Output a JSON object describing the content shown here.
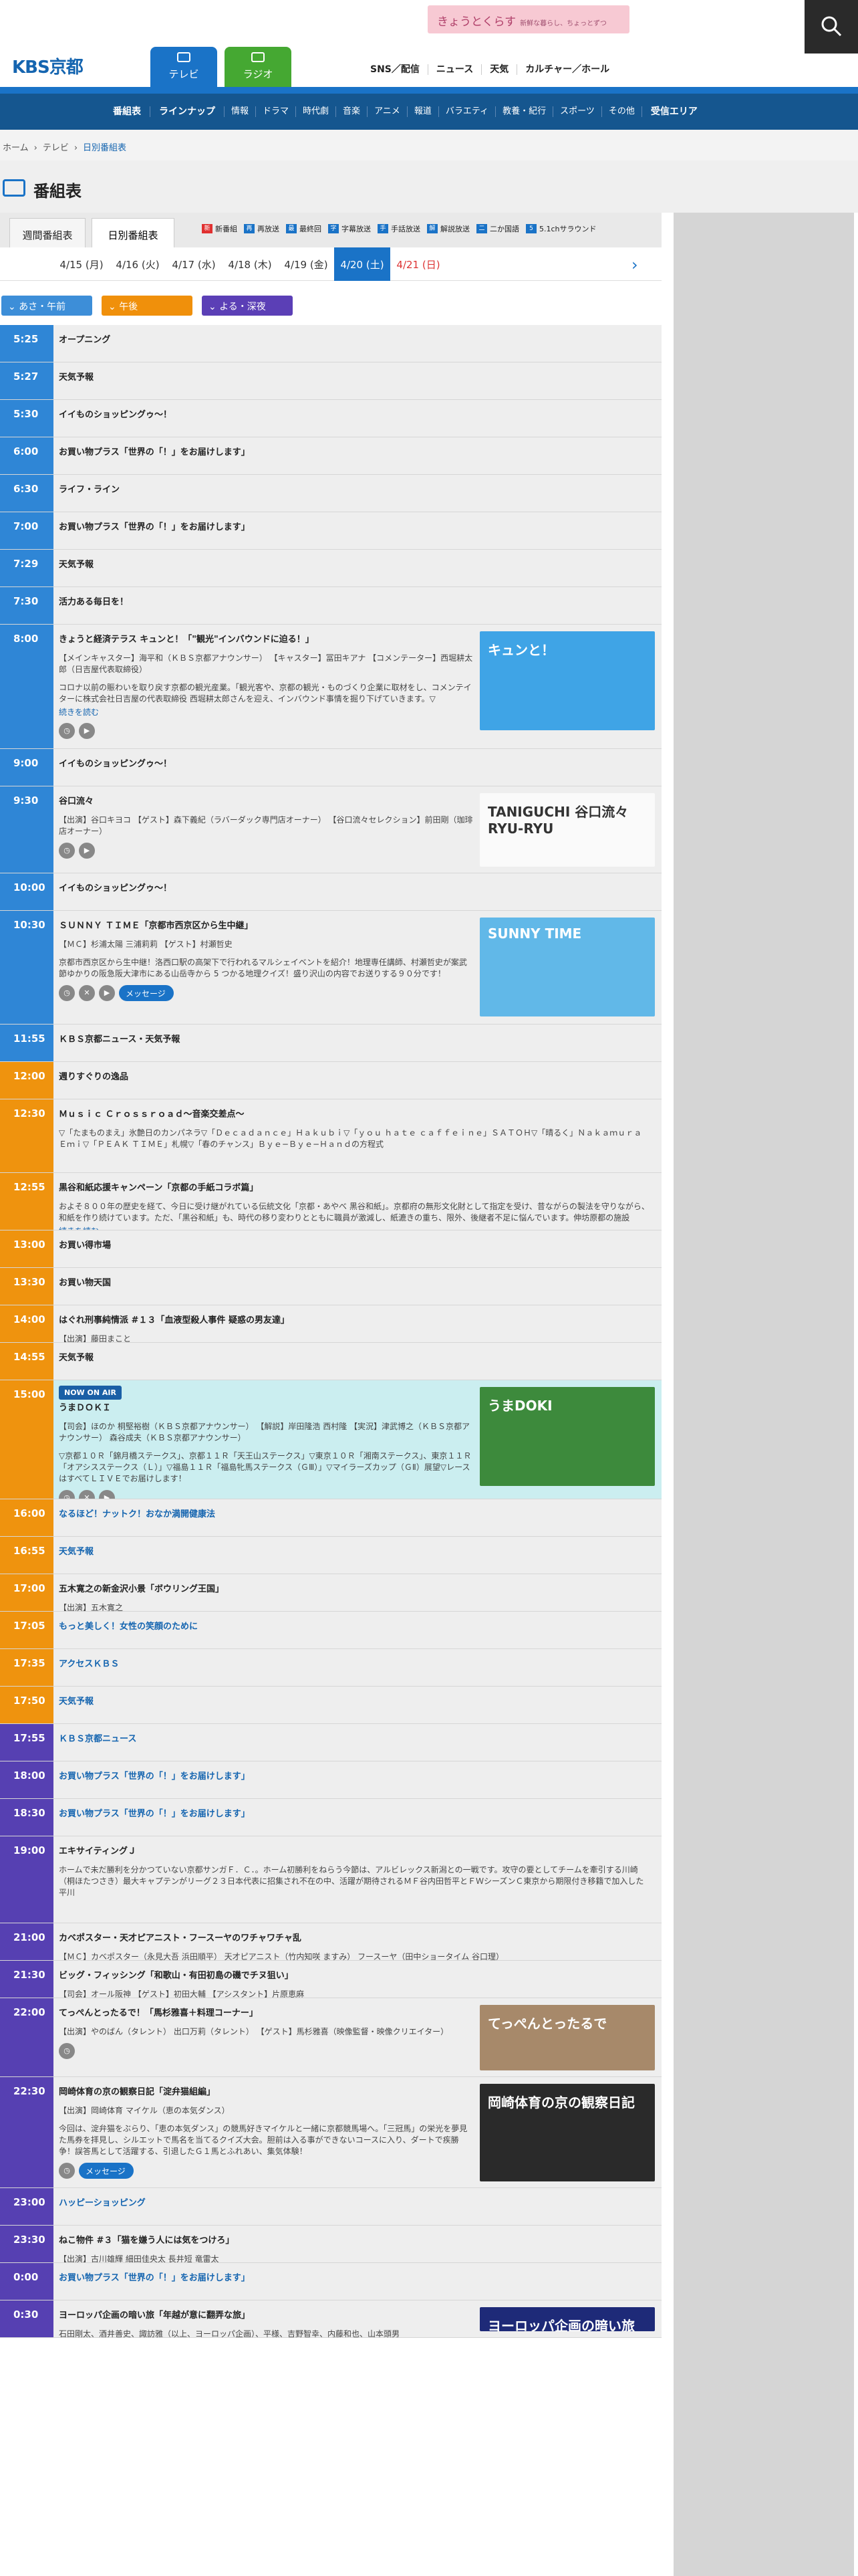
{
  "header": {
    "promo_text": "きょうとくらす",
    "promo_sub": "新鮮な暮らし、ちょっとずつ",
    "logo_text": "KBS京都",
    "tab_tv": "テレビ",
    "tab_radio": "ラジオ",
    "topnav": [
      "SNS／配信",
      "ニュース",
      "天気",
      "カルチャー／ホール"
    ]
  },
  "mainnav": [
    "番組表",
    "ラインナップ",
    "情報",
    "ドラマ",
    "時代劇",
    "音楽",
    "アニメ",
    "報道",
    "バラエティ",
    "教養・紀行",
    "スポーツ",
    "その他",
    "受信エリア"
  ],
  "breadcrumb": [
    "ホーム",
    "テレビ",
    "日別番組表"
  ],
  "page_title": "番組表",
  "tabs": {
    "weekly": "週間番組表",
    "daily": "日別番組表"
  },
  "legend": [
    {
      "mark": "新",
      "label": "新番組",
      "color": "#e03030"
    },
    {
      "mark": "再",
      "label": "再放送",
      "color": "#1a73c7"
    },
    {
      "mark": "最",
      "label": "最終回",
      "color": "#1a73c7"
    },
    {
      "mark": "字",
      "label": "字幕放送",
      "color": "#1a73c7"
    },
    {
      "mark": "手",
      "label": "手話放送",
      "color": "#1a73c7"
    },
    {
      "mark": "解",
      "label": "解説放送",
      "color": "#1a73c7"
    },
    {
      "mark": "二",
      "label": "二か国語",
      "color": "#1a73c7"
    },
    {
      "mark": "5",
      "label": "5.1chサラウンド",
      "color": "#1a73c7"
    }
  ],
  "dates": [
    "4/15 (月)",
    "4/16 (火)",
    "4/17 (水)",
    "4/18 (木)",
    "4/19 (金)",
    "4/20 (土)",
    "4/21 (日)"
  ],
  "filters": [
    "あさ・午前",
    "午後",
    "よる・深夜"
  ],
  "now_label": "NOW ON AIR",
  "more_label": "続きを読む",
  "message_label": "メッセージ",
  "programs": [
    {
      "time": "5:25",
      "title": "オープニング"
    },
    {
      "time": "5:27",
      "title": "天気予報"
    },
    {
      "time": "5:30",
      "title": "イイものショッピングゥ〜！"
    },
    {
      "time": "6:00",
      "title": "お買い物プラス「世界の「！」をお届けします」"
    },
    {
      "time": "6:30",
      "title": "ライフ・ライン"
    },
    {
      "time": "7:00",
      "title": "お買い物プラス「世界の「！」をお届けします」"
    },
    {
      "time": "7:29",
      "title": "天気予報"
    },
    {
      "time": "7:30",
      "title": "活力ある毎日を！"
    },
    {
      "time": "8:00",
      "title": "きょうと経済テラス キュンと！「\"観光\"インバウンドに迫る！」",
      "desc": "【メインキャスター】海平和（ＫＢＳ京都アナウンサー） 【キャスター】冨田キアナ 【コメンテーター】西堀耕太郎（日吉屋代表取締役）\nコロナ以前の賑わいを取り戻す京都の観光産業。「観光客や、京都の観光・ものづくり企業に取材をし、コメンテイターに株式会社日吉屋の代表取締役 西堀耕太郎さんを迎え、インバウンド事情を掘り下げていきます。▽",
      "thumb_caption": "キュンと！"
    },
    {
      "time": "9:00",
      "title": "イイものショッピングゥ〜！"
    },
    {
      "time": "9:30",
      "title": "谷口流々",
      "desc": "【出演】谷口キヨコ 【ゲスト】森下義紀（ラバーダック専門店オーナー） 【谷口流々セレクション】前田剛（珈琲店オーナー）",
      "thumb_caption": "TANIGUCHI 谷口流々 RYU-RYU"
    },
    {
      "time": "10:00",
      "title": "イイものショッピングゥ〜！"
    },
    {
      "time": "10:30",
      "title": "ＳＵＮＮＹ ＴＩＭＥ「京都市西京区から生中継」",
      "desc": "【ＭＣ】杉浦太陽 三浦莉莉 【ゲスト】村瀬哲史\n京都市西京区から生中継！洛西口駅の高架下で行われるマルシェイベントを紹介！地理専任講師、村瀬哲史が案武節ゆかりの阪急阪大津市にある山岳寺から 5 つかる地理クイズ！盛り沢山の内容でお送りする９０分です！",
      "thumb_caption": "SUNNY TIME"
    },
    {
      "time": "11:55",
      "title": "ＫＢＳ京都ニュース・天気予報"
    },
    {
      "time": "12:00",
      "title": "週りすぐりの逸品"
    },
    {
      "time": "12:30",
      "title": "Ｍｕｓｉｃ Ｃｒｏｓｓｒｏａｄ〜音楽交差点〜",
      "desc": "▽「たまものまえ」氷艶日のカンパネラ▽「Ｄｅｃａｄａｎｃｅ」Ｈａｋｕｂｉ▽「ｙｏｕ ｈａｔｅ ｃａｆｆｅｉｎｅ」ＳＡＴＯＨ▽「晴るく」Ｎａｋａｍｕｒａ Ｅｍｉ▽「ＰＥＡＫ ＴＩＭＥ」札幌▽「春のチャンス」Ｂｙｅ−Ｂｙｅ−Ｈａｎｄの方程式"
    },
    {
      "time": "12:55",
      "title": "黒谷和紙応援キャンペーン「京都の手紙コラボ篇」",
      "desc": "およそ８００年の歴史を経て、今日に受け継がれている伝統文化「京都・あやべ 黒谷和紙」。京都府の無形文化財として指定を受け、昔ながらの製法を守りながら、和紙を作り続けています。ただ、「黒谷和紙」も、時代の移り変わりとともに職員が激減し、紙漉きの重ち、限外、後継者不足に悩んでいます。伸坊原都の施設"
    },
    {
      "time": "13:00",
      "title": "お買い得市場"
    },
    {
      "time": "13:30",
      "title": "お買い物天国"
    },
    {
      "time": "14:00",
      "title": "はぐれ刑事純情派 #１３「血液型殺人事件 疑惑の男友達」",
      "desc": "【出演】藤田まこと"
    },
    {
      "time": "14:55",
      "title": "天気予報"
    },
    {
      "time": "15:00",
      "title": "うまＤＯＫＩ",
      "desc": "【司会】ほのか 桐堅裕樹（ＫＢＳ京都アナウンサー） 【解説】岸田隆浩 西村隆 【実況】津武博之（ＫＢＳ京都アナウンサー） 森谷成夫（ＫＢＳ京都アナウンサー）\n▽京都１０Ｒ「錦月橋ステークス」、京都１１Ｒ「天王山ステークス」▽東京１０Ｒ「湘南ステークス」、東京１１Ｒ「オアシスステークス（Ｌ）」▽福島１１Ｒ「福島牝馬ステークス（ＧⅢ）」▽マイラーズカップ（ＧⅡ）展望▽レースはすべてＬＩＶＥでお届けします！",
      "thumb_caption": "うまDOKI"
    },
    {
      "time": "16:00",
      "title": "なるほど！ナットク！おなか満開健康法"
    },
    {
      "time": "16:55",
      "title": "天気予報"
    },
    {
      "time": "17:00",
      "title": "五木寛之の新金沢小景「ボウリング王国」",
      "desc": "【出演】五木寛之"
    },
    {
      "time": "17:05",
      "title": "もっと美しく！女性の笑顔のために"
    },
    {
      "time": "17:35",
      "title": "アクセスＫＢＳ"
    },
    {
      "time": "17:50",
      "title": "天気予報"
    },
    {
      "time": "17:55",
      "title": "ＫＢＳ京都ニュース"
    },
    {
      "time": "18:00",
      "title": "お買い物プラス「世界の「！」をお届けします」"
    },
    {
      "time": "18:30",
      "title": "お買い物プラス「世界の「！」をお届けします」"
    },
    {
      "time": "19:00",
      "title": "エキサイティングＪ",
      "desc": "ホームで未だ勝利を分かつていない京都サンガＦ．Ｃ．。ホーム初勝利をねらう今節は、アルビレックス新潟との一戦です。攻守の要としてチームを牽引する川崎（桐ほたつさき）最大キャプテンがリーグ２３日本代表に招集され不在の中、活躍が期待されるＭＦ谷内田哲平とＦＷシーズンＣ東京から期限付き移籍で加入した平川"
    },
    {
      "time": "21:00",
      "title": "カベポスター・天才ピアニスト・フースーヤのワチャワチャ乱",
      "desc": "【ＭＣ】カベポスター（永見大吾 浜田順平） 天才ピアニスト（竹内知咲 ますみ） フースーヤ（田中ショータイム 谷口理）"
    },
    {
      "time": "21:30",
      "title": "ビッグ・フィッシング「和歌山・有田初島の磯でチヌ狙い」",
      "desc": "【司会】オール阪神 【ゲスト】初田大輔 【アシスタント】片原恵麻"
    },
    {
      "time": "22:00",
      "title": "てっぺんとったるで！「馬杉雅喜＋料理コーナー」",
      "desc": "【出演】やのばん（タレント） 出口万莉（タレント） 【ゲスト】馬杉雅喜（映像監督・映像クリエイター）",
      "thumb_caption": "てっぺんとったるで"
    },
    {
      "time": "22:30",
      "title": "岡崎体育の京の観察日記「淀弁猫組編」",
      "desc": "【出演】岡崎体育 マイケル（恵の本気ダンス）\n今回は、淀弁猫をぶらり、「恵の本気ダンス」の競馬好きマイケルと一緒に京都競馬場へ。「三冠馬」の栄光を夢見た馬券を拝見し、シルエットで馬名を当てるクイズ大会。胆前は入る事ができないコースに入り、ダートで疾勝争！誤答馬として活躍する、引退したＧ１馬とふれあい、集気体験！",
      "thumb_caption": "岡崎体育の京の観察日記"
    },
    {
      "time": "23:00",
      "title": "ハッピーショッピング"
    },
    {
      "time": "23:30",
      "title": "ねこ物件 #３「猫を嫌う人には気をつけろ」",
      "desc": "【出演】古川雄輝 細田佳央太 長井短 竜雷太"
    },
    {
      "time": "0:00",
      "title": "お買い物プラス「世界の「！」をお届けします」"
    },
    {
      "time": "0:30",
      "title": "ヨーロッパ企画の暗い旅「年越が意に翻弄な旅」",
      "desc": "石田剛太、酒井善史、諏訪雅（以上、ヨーロッパ企画）、平様、吉野智幸、内藤和也、山本頭男",
      "thumb_caption": "ヨーロッパ企画の暗い旅"
    }
  ]
}
